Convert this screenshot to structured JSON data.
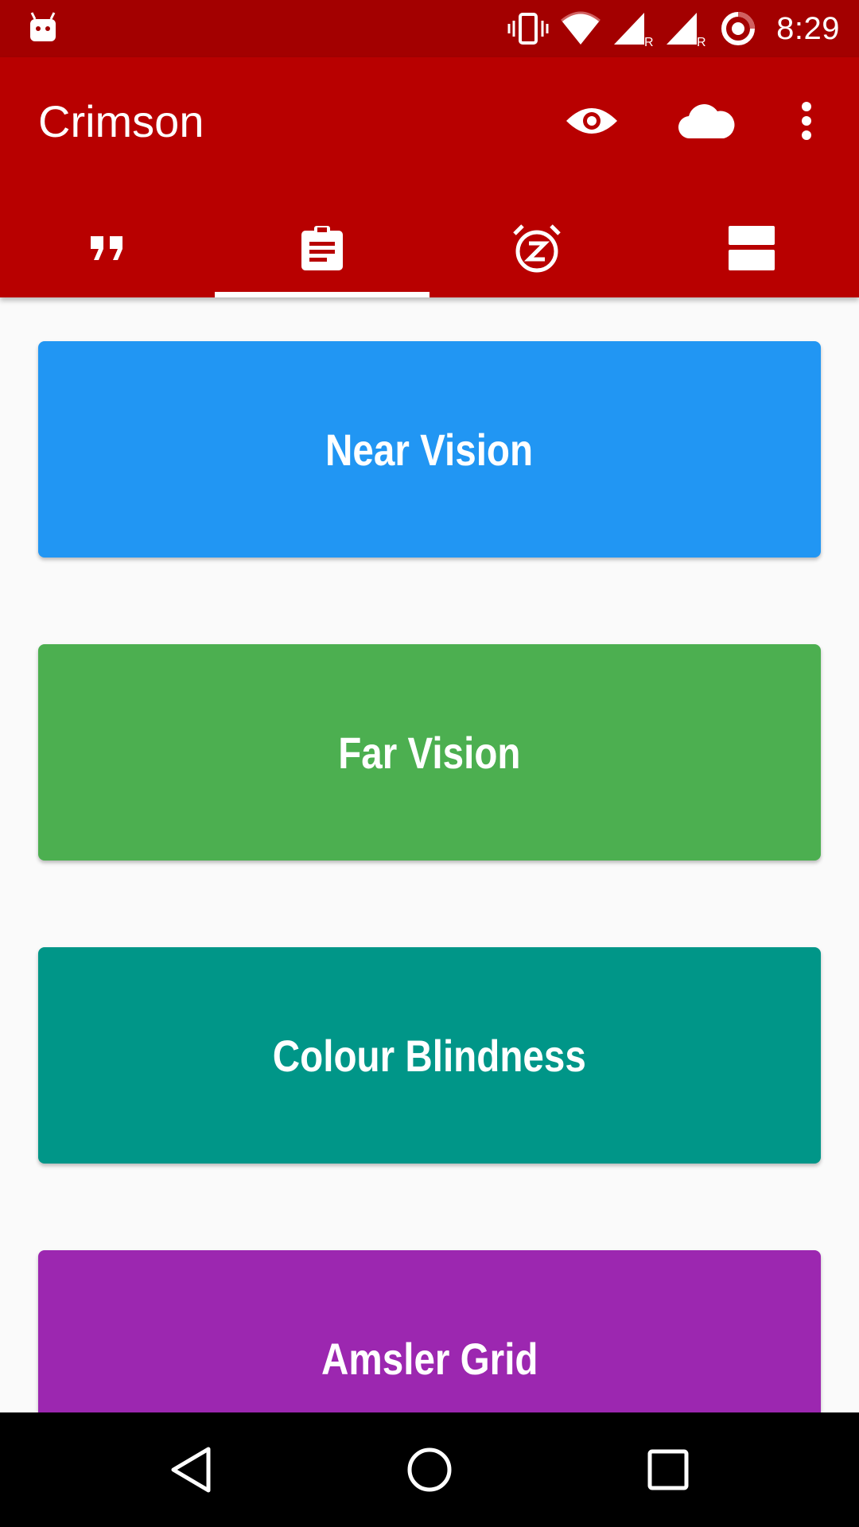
{
  "status_bar": {
    "time": "8:29",
    "icons": [
      "android-debug-icon",
      "vibrate-icon",
      "wifi-icon",
      "signal-r-icon",
      "signal-r-icon",
      "sync-icon"
    ],
    "background": "#a30000"
  },
  "app_bar": {
    "title": "Crimson",
    "background": "#b80000",
    "actions": [
      "eye-icon",
      "cloud-icon",
      "more-vert-icon"
    ]
  },
  "tabs": [
    {
      "icon": "quote-icon",
      "selected": false
    },
    {
      "icon": "clipboard-icon",
      "selected": true
    },
    {
      "icon": "snooze-alarm-icon",
      "selected": false
    },
    {
      "icon": "split-view-icon",
      "selected": false
    }
  ],
  "cards": [
    {
      "label": "Near Vision",
      "color": "#2196f3"
    },
    {
      "label": "Far Vision",
      "color": "#4caf50"
    },
    {
      "label": "Colour Blindness",
      "color": "#009688"
    },
    {
      "label": "Amsler Grid",
      "color": "#9c27b0"
    }
  ],
  "nav_bar": [
    "back-icon",
    "home-icon",
    "recents-icon"
  ]
}
